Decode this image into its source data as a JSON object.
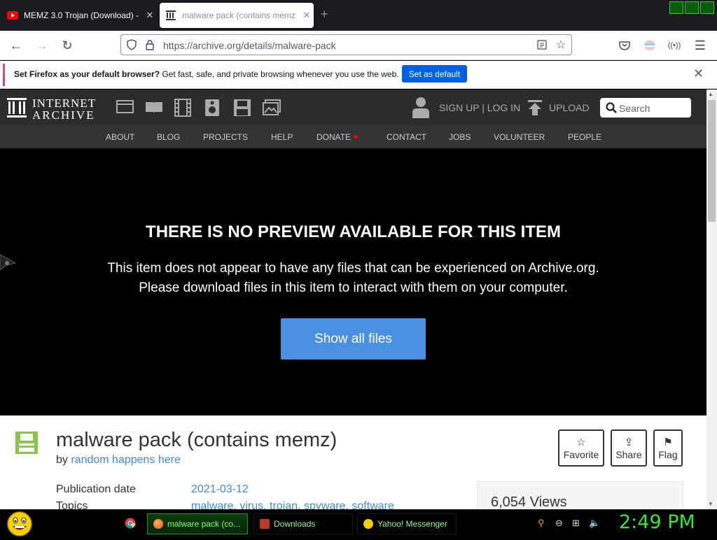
{
  "browser": {
    "tabs": [
      {
        "label": "MEMZ 3.0 Trojan (Download) -",
        "icon": "youtube-icon",
        "active": false
      },
      {
        "label": "malware pack (contains memz",
        "icon": "archive-icon",
        "active": true
      }
    ],
    "url": "https://archive.org/details/malware-pack",
    "notification": {
      "bold": "Set Firefox as your default browser?",
      "text": " Get fast, safe, and private browsing whenever you use the web.",
      "button": "Set as default"
    }
  },
  "archive": {
    "logo_line1": "INTERNET",
    "logo_line2": "ARCHIVE",
    "signup": "SIGN UP | LOG IN",
    "upload": "UPLOAD",
    "search_placeholder": "Search",
    "nav": [
      "ABOUT",
      "BLOG",
      "PROJECTS",
      "HELP",
      "DONATE",
      "CONTACT",
      "JOBS",
      "VOLUNTEER",
      "PEOPLE"
    ],
    "donate_heart_color": "#ff0000"
  },
  "preview": {
    "title": "THERE IS NO PREVIEW AVAILABLE FOR THIS ITEM",
    "line1": "This item does not appear to have any files that can be experienced on Archive.org.",
    "line2": "Please download files in this item to interact with them on your computer.",
    "button": "Show all files",
    "button_color": "#4a90e2"
  },
  "item": {
    "title": "malware pack (contains memz)",
    "by_prefix": "by ",
    "author": "random happens here",
    "actions": [
      "Favorite",
      "Share",
      "Flag"
    ],
    "pubdate_label": "Publication date",
    "pubdate": "2021-03-12",
    "topics_label": "Topics",
    "topics": "malware, virus, trojan, spyware, software",
    "views": "6,054 Views",
    "icon_color": "#8ac44a"
  },
  "taskbar": {
    "buttons": [
      "malware pack (co...",
      "Downloads",
      "Yahoo! Messenger"
    ],
    "clock": "2:49 PM"
  }
}
